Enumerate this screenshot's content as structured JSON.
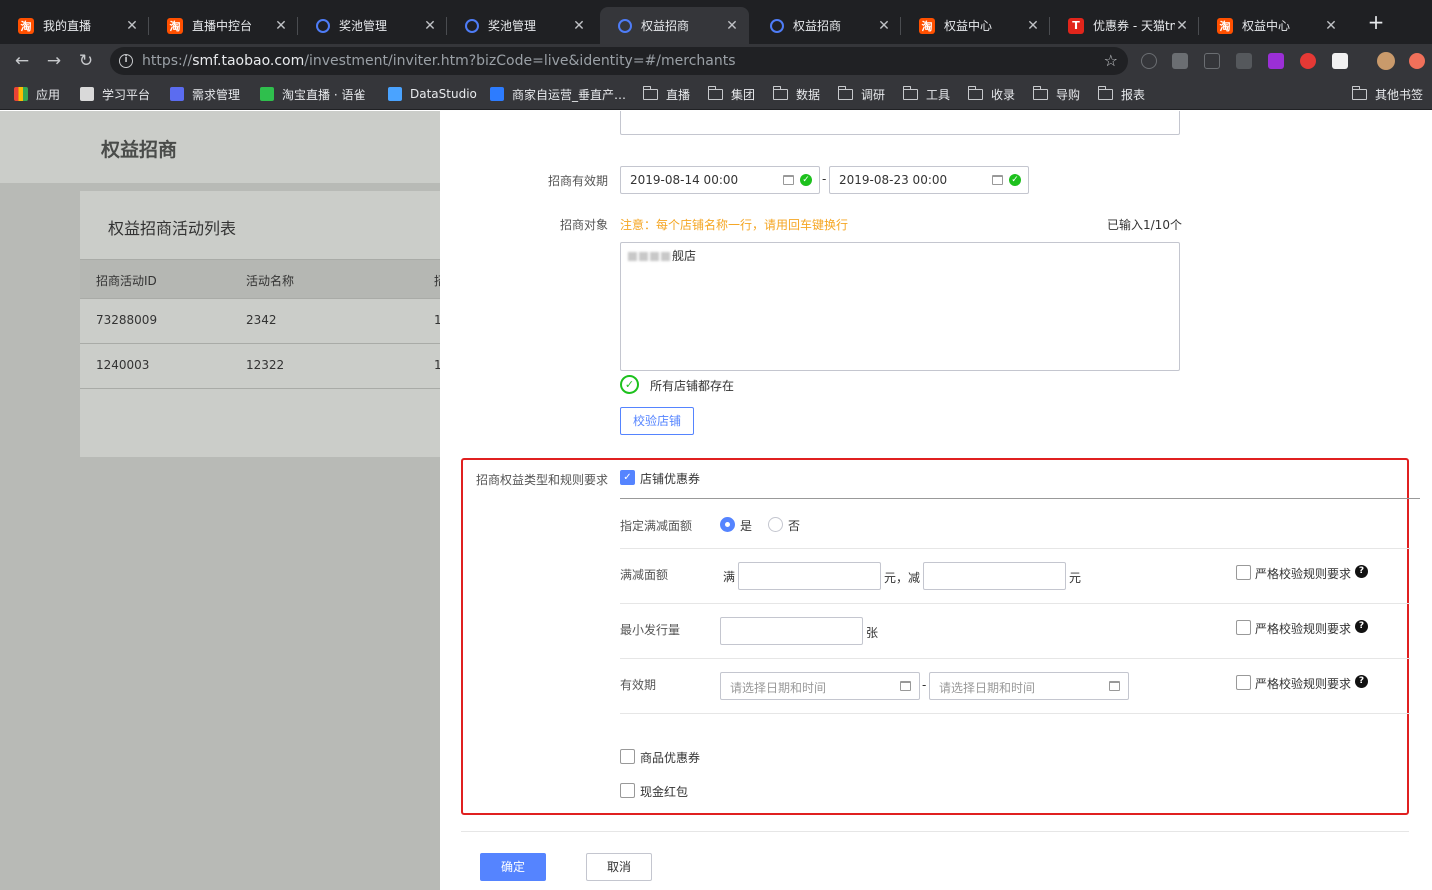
{
  "browser": {
    "tabs": [
      {
        "title": "我的直播",
        "favicon": "taobao-icon"
      },
      {
        "title": "直播中控台",
        "favicon": "taobao-icon"
      },
      {
        "title": "奖池管理",
        "favicon": "ring-icon"
      },
      {
        "title": "奖池管理",
        "favicon": "ring-icon"
      },
      {
        "title": "权益招商",
        "favicon": "ring-icon",
        "active": true
      },
      {
        "title": "权益招商",
        "favicon": "ring-icon"
      },
      {
        "title": "权益中心",
        "favicon": "taobao-icon"
      },
      {
        "title": "优惠券 - 天猫tm",
        "favicon": "tmall-icon"
      },
      {
        "title": "权益中心",
        "favicon": "taobao-icon"
      }
    ],
    "url_scheme": "https://",
    "url_host": "smf.taobao.com",
    "url_path": "/investment/inviter.htm?bizCode=live&identity=#/merchants",
    "bookmarks": [
      {
        "label": "应用",
        "icon": "apps-icon"
      },
      {
        "label": "学习平台",
        "icon": "bookmark-icon"
      },
      {
        "label": "需求管理",
        "icon": "bookmark-icon"
      },
      {
        "label": "淘宝直播 · 语雀",
        "icon": "bookmark-icon"
      },
      {
        "label": "DataStudio",
        "icon": "bookmark-icon"
      },
      {
        "label": "商家自运营_垂直产…",
        "icon": "bookmark-icon"
      },
      {
        "label": "直播",
        "icon": "folder-icon"
      },
      {
        "label": "集团",
        "icon": "folder-icon"
      },
      {
        "label": "数据",
        "icon": "folder-icon"
      },
      {
        "label": "调研",
        "icon": "folder-icon"
      },
      {
        "label": "工具",
        "icon": "folder-icon"
      },
      {
        "label": "收录",
        "icon": "folder-icon"
      },
      {
        "label": "导购",
        "icon": "folder-icon"
      },
      {
        "label": "报表",
        "icon": "folder-icon"
      }
    ],
    "other_bookmarks": "其他书签"
  },
  "left_page": {
    "title": "权益招商",
    "card_title": "权益招商活动列表",
    "columns": [
      "招商活动ID",
      "活动名称",
      "招"
    ],
    "rows": [
      [
        "73288009",
        "2342",
        "1"
      ],
      [
        "1240003",
        "12322",
        "1"
      ]
    ]
  },
  "form": {
    "validity": {
      "label": "招商有效期",
      "start": "2019-08-14 00:00",
      "end": "2019-08-23 00:00",
      "separator": "-"
    },
    "target": {
      "label": "招商对象",
      "notice": "注意：每个店铺名称一行，请用回车键换行",
      "count": "已输入1/10个",
      "value_visible_suffix": "舰店",
      "status": "所有店铺都存在",
      "verify_button": "校验店铺"
    },
    "rights": {
      "label": "招商权益类型和规则要求",
      "shop_coupon": {
        "label": "店铺优惠券",
        "checked": true,
        "fixed_amount": {
          "label": "指定满减面额",
          "options": [
            "是",
            "否"
          ],
          "selected": "是"
        },
        "amount": {
          "label": "满减面额",
          "prefix": "满",
          "mid": "元，减",
          "suffix": "元",
          "threshold": "",
          "discount": ""
        },
        "min_issue": {
          "label": "最小发行量",
          "unit": "张",
          "value": ""
        },
        "period": {
          "label": "有效期",
          "start_placeholder": "请选择日期和时间",
          "end_placeholder": "请选择日期和时间",
          "separator": "-"
        },
        "strict_label": "严格校验规则要求"
      },
      "goods_coupon": {
        "label": "商品优惠券",
        "checked": false
      },
      "cash_redpacket": {
        "label": "现金红包",
        "checked": false
      }
    },
    "actions": {
      "confirm": "确定",
      "cancel": "取消"
    }
  },
  "colors": {
    "primary": "#5584ff",
    "warning": "#f5a623",
    "success": "#1dc11d",
    "highlight_frame": "#e02020"
  }
}
